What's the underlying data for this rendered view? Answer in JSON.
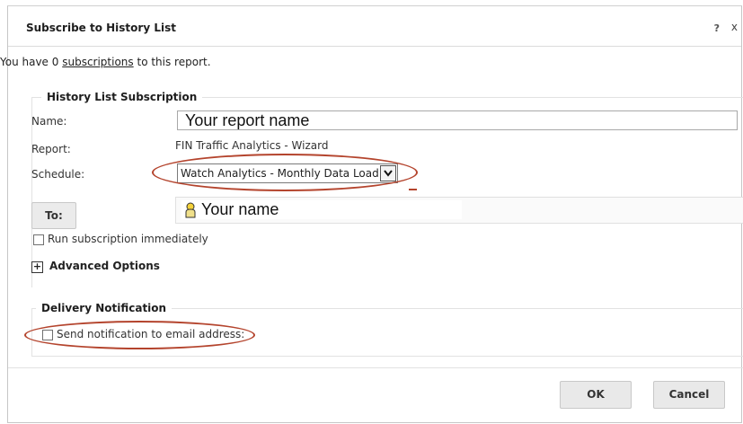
{
  "dialog": {
    "title": "Subscribe to History List",
    "help_label": "?",
    "close_label": "x"
  },
  "intro": {
    "prefix": "You have 0 ",
    "link": "subscriptions",
    "suffix": " to this report."
  },
  "history_section": {
    "legend": "History List Subscription",
    "name_label": "Name:",
    "name_value": "Your report name",
    "report_label": "Report:",
    "report_value": "FIN Traffic Analytics - Wizard",
    "schedule_label": "Schedule:",
    "schedule_value": "Watch Analytics - Monthly Data Load",
    "to_button": "To:",
    "recipient": "Your name",
    "run_immediately_label": "Run subscription immediately",
    "run_immediately_checked": false
  },
  "advanced": {
    "toggle": "+",
    "label": "Advanced Options"
  },
  "delivery_section": {
    "legend": "Delivery Notification",
    "email_label": "Send notification to email address:",
    "email_checked": false
  },
  "footer": {
    "ok_label": "OK",
    "cancel_label": "Cancel"
  },
  "colors": {
    "highlight_oval": "#b4442d",
    "button_bg": "#e9e9e9",
    "border": "#e2e2e2"
  },
  "icons": {
    "recipient": "user-icon",
    "schedule_dropdown": "chevron-down-icon"
  }
}
